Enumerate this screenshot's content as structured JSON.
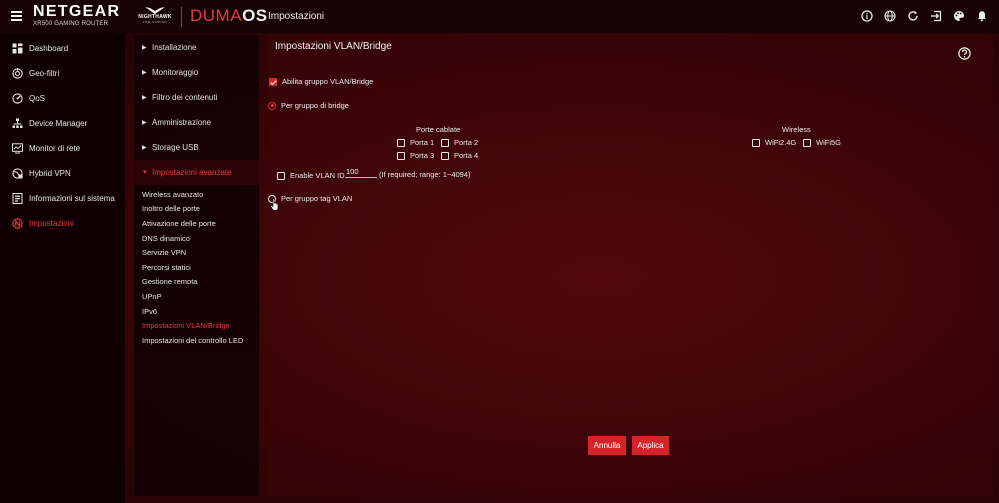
{
  "app": {
    "brand": "NETGEAR",
    "brand_sub": "XR500 GAMING ROUTER",
    "nighthawk": "NIGHTHAWK",
    "nighthawk_sub": "PRO GAMING",
    "duma_part1": "DUMA",
    "duma_part2": "OS",
    "page_title": "Impostazioni",
    "accent_color": "#d9262d"
  },
  "top_icons": [
    "info-icon",
    "globe-icon",
    "refresh-icon",
    "logout-icon",
    "palette-icon",
    "bell-icon"
  ],
  "sidebar": {
    "items": [
      {
        "label": "Dashboard",
        "icon": "dashboard-icon"
      },
      {
        "label": "Geo-filtri",
        "icon": "geo-filter-icon"
      },
      {
        "label": "QoS",
        "icon": "qos-icon"
      },
      {
        "label": "Device Manager",
        "icon": "device-manager-icon"
      },
      {
        "label": "Monitor di rete",
        "icon": "network-monitor-icon"
      },
      {
        "label": "Hybrid VPN",
        "icon": "vpn-icon"
      },
      {
        "label": "Informazioni sul sistema",
        "icon": "system-info-icon"
      },
      {
        "label": "Impostazioni",
        "icon": "settings-icon",
        "active": true
      }
    ]
  },
  "menu": {
    "items": [
      {
        "label": "Installazione"
      },
      {
        "label": "Monitoraggio"
      },
      {
        "label": "Filtro dei contenuti"
      },
      {
        "label": "Amministrazione"
      },
      {
        "label": "Storage USB"
      },
      {
        "label": "Impostazioni avanzate",
        "expanded": true
      }
    ],
    "subitems": [
      {
        "label": "Wireless avanzato"
      },
      {
        "label": "Inoltro delle porte"
      },
      {
        "label": "Attivazione delle porte"
      },
      {
        "label": "DNS dinamico"
      },
      {
        "label": "Servizio VPN"
      },
      {
        "label": "Percorsi statici"
      },
      {
        "label": "Gestione remota"
      },
      {
        "label": "UPnP"
      },
      {
        "label": "IPv6"
      },
      {
        "label": "Impostazioni VLAN/Bridge",
        "active": true
      },
      {
        "label": "Impostazioni del controllo LED"
      }
    ]
  },
  "panel": {
    "title": "Impostazioni VLAN/Bridge",
    "enable_label": "Abilita gruppo VLAN/Bridge",
    "enable_checked": true,
    "bridge_label": "Per gruppo di bridge",
    "bridge_selected": true,
    "wired_heading": "Porte cablate",
    "ports": [
      "Porta 1",
      "Porta 2",
      "Porta 3",
      "Porta 4"
    ],
    "wireless_heading": "Wireless",
    "wireless": [
      "WiFi2.4G",
      "WiFi5G"
    ],
    "vlan_enable_label": "Enable VLAN ID",
    "vlan_id": "100",
    "vlan_hint": "(If required; range: 1~4094)",
    "tag_label": "Per gruppo tag VLAN",
    "tag_selected": false
  },
  "buttons": {
    "cancel": "Annulla",
    "apply": "Applica"
  }
}
